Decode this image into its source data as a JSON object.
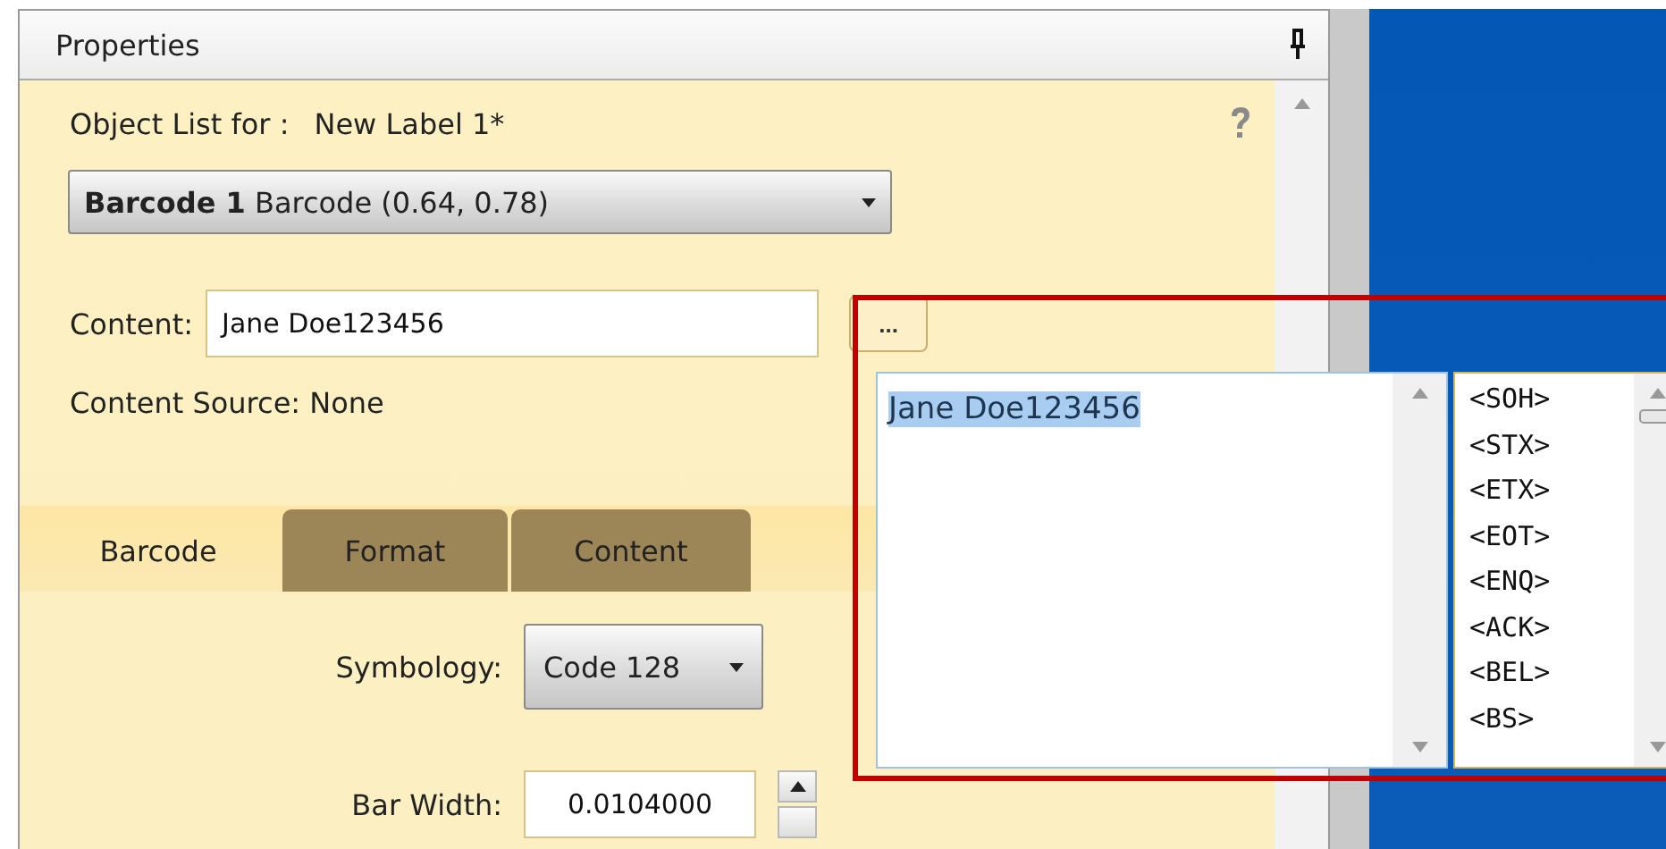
{
  "panel": {
    "title": "Properties",
    "object_list_label": "Object List for :",
    "object_list_value": "New Label 1*",
    "object_select": "**Barcode 1** Barcode (0.64, 0.78)",
    "content": {
      "label": "Content:",
      "value": "Jane Doe123456",
      "browse_button": "..."
    },
    "content_source": "Content Source: None",
    "tabs": [
      {
        "label": "Barcode",
        "selected": true
      },
      {
        "label": "Format",
        "selected": false
      },
      {
        "label": "Content",
        "selected": false
      }
    ],
    "symbology": {
      "label": "Symbology:",
      "value": "Code 128"
    },
    "bar_width": {
      "label": "Bar Width:",
      "value": "0.0104000"
    }
  },
  "editor_popup": {
    "text": "Jane Doe123456",
    "text_selected": true,
    "control_codes": [
      "<SOH>",
      "<STX>",
      "<ETX>",
      "<EOT>",
      "<ENQ>",
      "<ACK>",
      "<BEL>",
      "<BS>"
    ]
  }
}
